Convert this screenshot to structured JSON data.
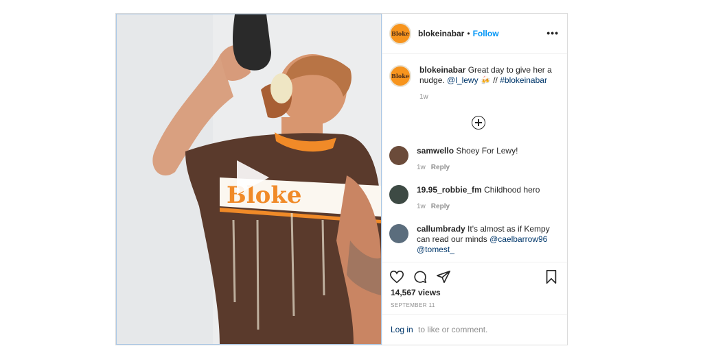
{
  "post": {
    "username": "blokeinabar",
    "dot": "•",
    "follow_label": "Follow",
    "more_label": "•••",
    "logo_text": "Bloke",
    "caption": {
      "username": "blokeinabar",
      "text": "Great day to give her a nudge.",
      "mention": "@l_lewy",
      "emoji": "🍻",
      "sep": "//",
      "hashtag": "#blokeinabar",
      "time": "1w"
    },
    "comments": [
      {
        "username": "samwello",
        "text": "Shoey For Lewy!",
        "time": "1w",
        "reply": "Reply"
      },
      {
        "username": "19.95_robbie_fm",
        "text": "Childhood hero",
        "time": "1w",
        "reply": "Reply"
      },
      {
        "username": "callumbrady",
        "text": "It's almost as if Kempy can read our minds",
        "mention1": "@caelbarrow96",
        "mention2": "@tomest_"
      }
    ],
    "views": "14,567 views",
    "date": "SEPTEMBER 11",
    "login_link": "Log in",
    "login_text": "to like or comment."
  },
  "icons": [
    "heart-icon",
    "comment-icon",
    "share-icon",
    "bookmark-icon",
    "add-comment-icon",
    "play-icon"
  ],
  "colors": {
    "link": "#00376b",
    "follow": "#0095f6",
    "brand_orange": "#f7941d",
    "shirt_brown": "#5a3a2c"
  }
}
